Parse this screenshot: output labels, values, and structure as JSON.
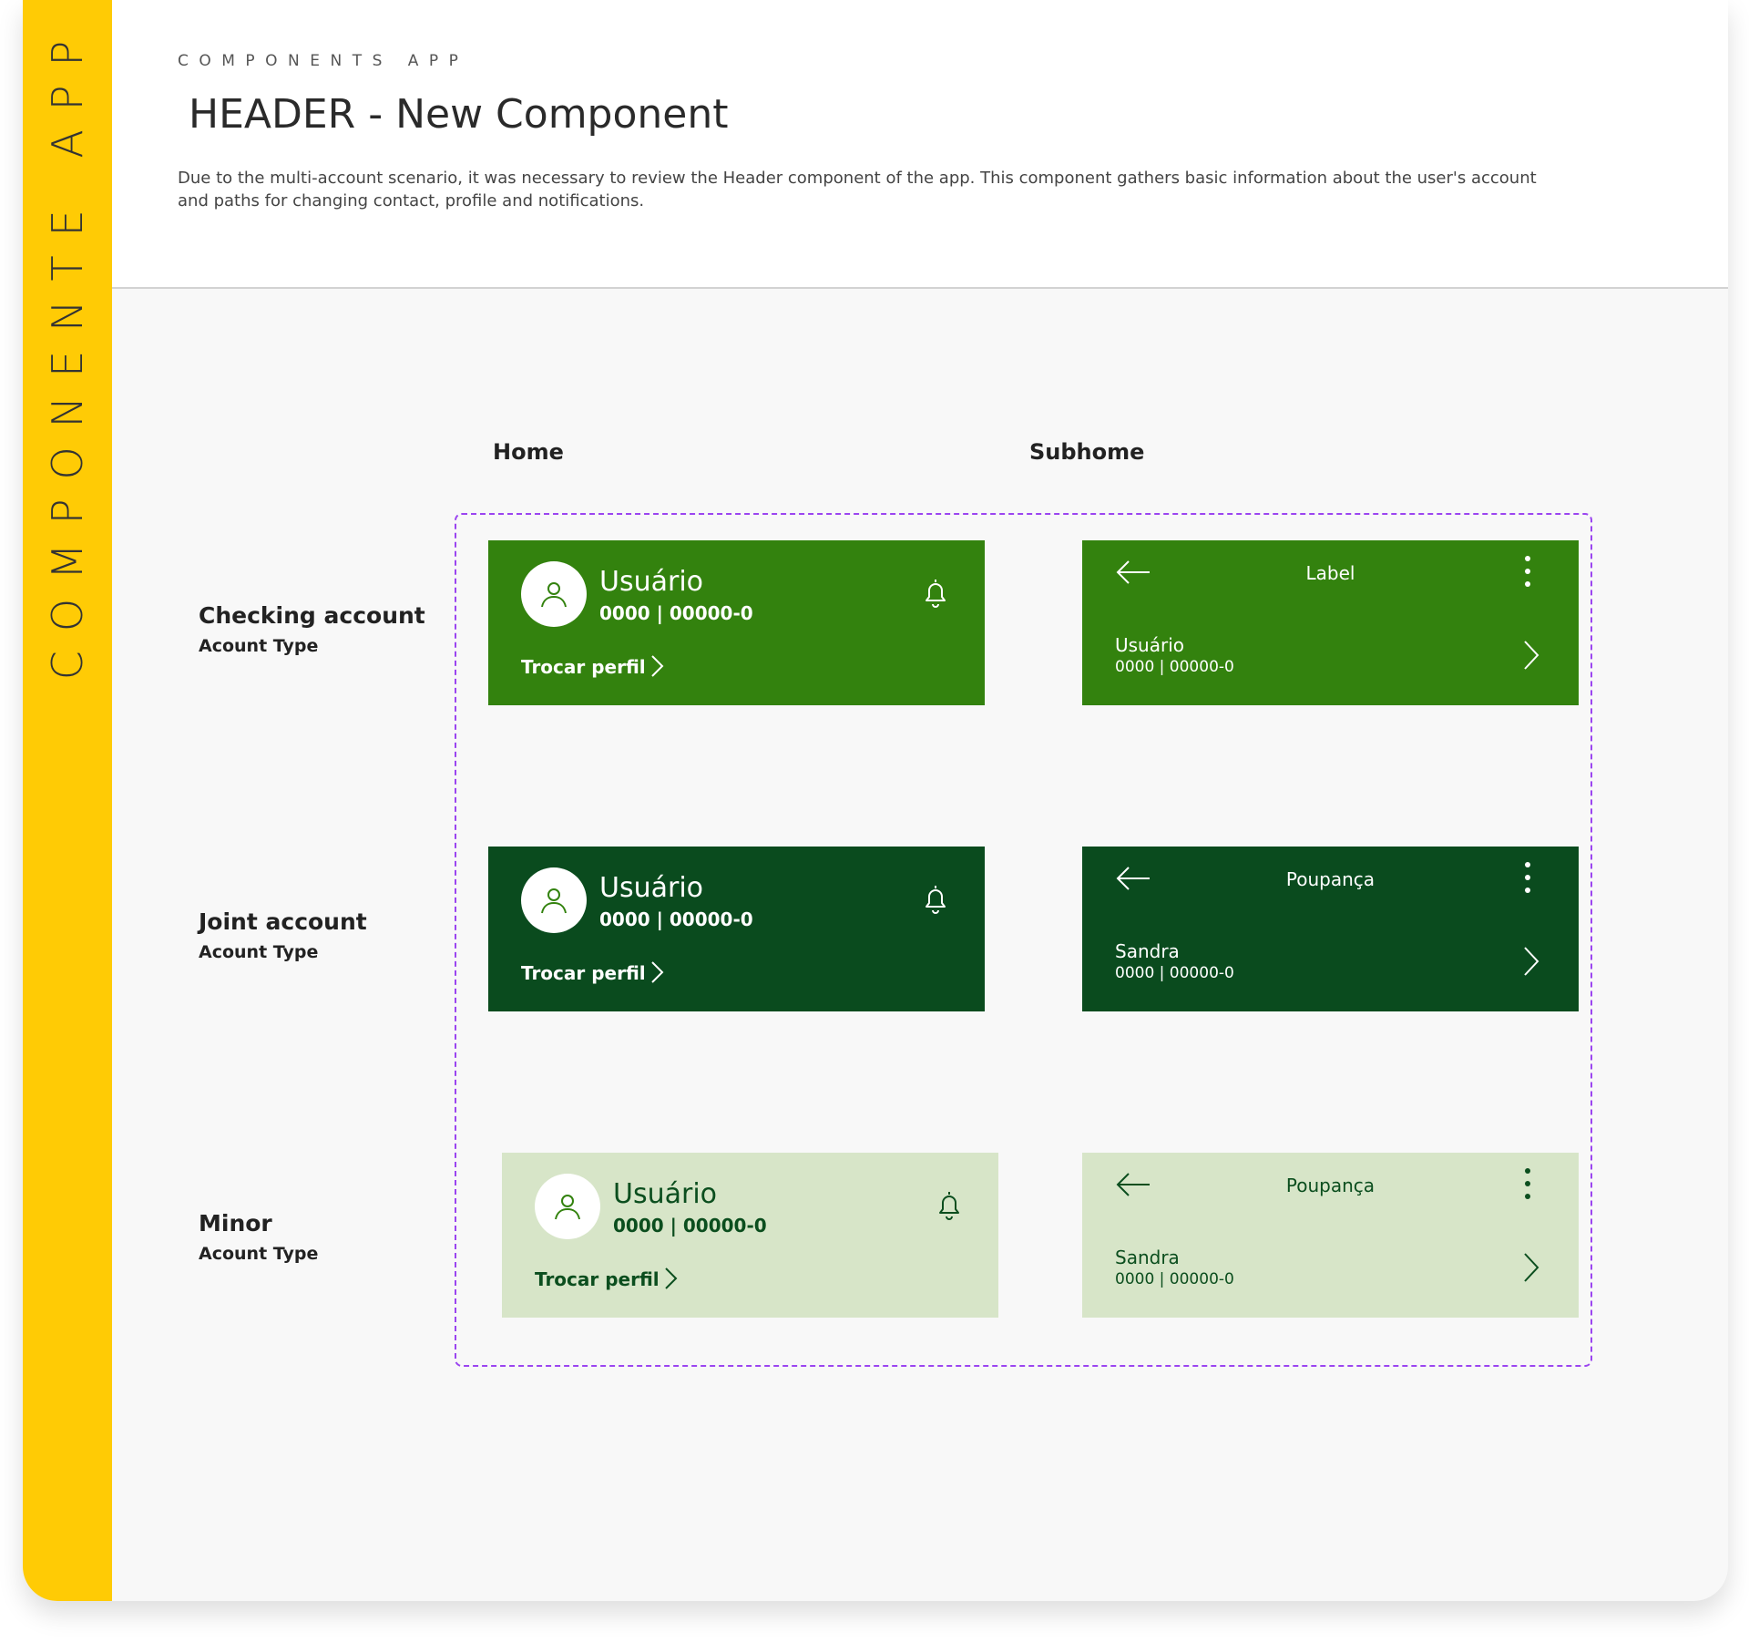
{
  "sidebar": {
    "title": "COMPONENTE APP"
  },
  "header": {
    "eyebrow": "COMPONENTS APP",
    "title": "HEADER - New Component",
    "description": "Due to the multi-account scenario, it was necessary to review the Header component of the app. This component gathers basic information about the user's account and paths for changing contact, profile and notifications."
  },
  "columns": {
    "home": "Home",
    "subhome": "Subhome"
  },
  "colors": {
    "sidebar": "#ffcb05",
    "checking_bg": "#33820e",
    "joint_bg": "#0a4b1e",
    "minor_bg": "#d7e5c8",
    "minor_text": "#0b4e1e",
    "frame": "#9b45f0"
  },
  "rows": [
    {
      "title": "Checking account",
      "subtitle": "Acount Type",
      "home": {
        "name": "Usuário",
        "account": "0000 | 00000-0",
        "switch_label": "Trocar perfil"
      },
      "subhome": {
        "label": "Label",
        "name": "Usuário",
        "account": "0000 | 00000-0"
      }
    },
    {
      "title": "Joint account",
      "subtitle": "Acount Type",
      "home": {
        "name": "Usuário",
        "account": "0000 | 00000-0",
        "switch_label": "Trocar perfil"
      },
      "subhome": {
        "label": "Poupança",
        "name": "Sandra",
        "account": "0000 | 00000-0"
      }
    },
    {
      "title": "Minor",
      "subtitle": "Acount Type",
      "home": {
        "name": "Usuário",
        "account": "0000 | 00000-0",
        "switch_label": "Trocar perfil"
      },
      "subhome": {
        "label": "Poupança",
        "name": "Sandra",
        "account": "0000 | 00000-0"
      }
    }
  ],
  "icons": [
    "user-icon",
    "bell-icon",
    "chevron-right-icon",
    "arrow-left-icon",
    "more-vertical-icon"
  ]
}
